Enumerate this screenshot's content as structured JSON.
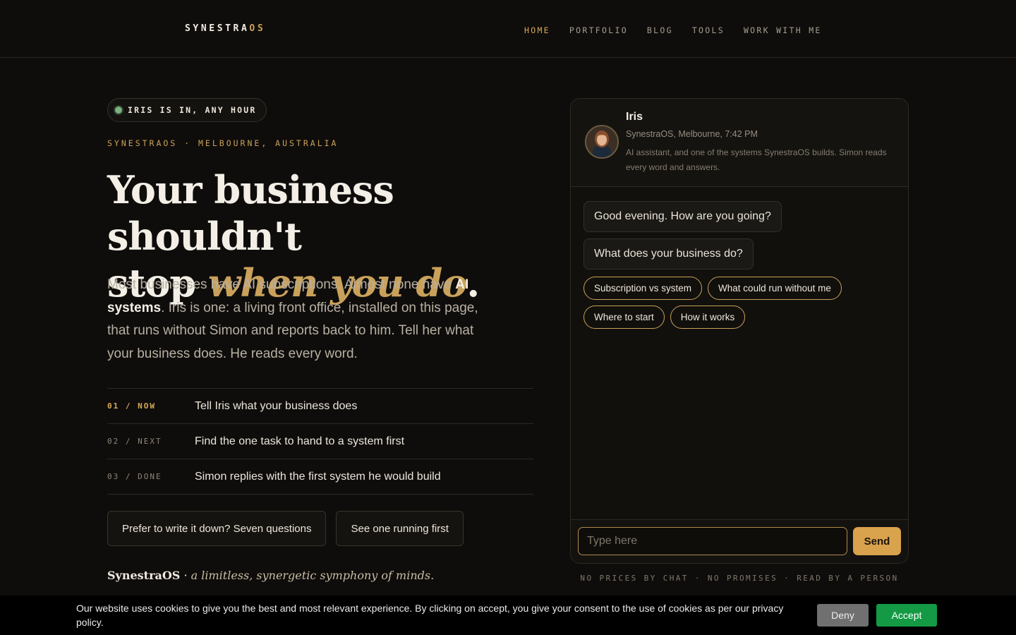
{
  "header": {
    "logo_main": "SYNESTRA",
    "logo_accent": "OS",
    "nav": [
      "HOME",
      "PORTFOLIO",
      "BLOG",
      "TOOLS",
      "WORK WITH ME"
    ]
  },
  "hero": {
    "status_pill": "IRIS IS IN, ANY HOUR",
    "location": "SYNESTRAOS · MELBOURNE, AUSTRALIA",
    "headline_1": "Your business shouldn't",
    "headline_2": "stop ",
    "headline_em": "when you do",
    "headline_end": ".",
    "lede_1": "Most businesses have AI subscriptions. Almost none have ",
    "lede_bold": "AI systems",
    "lede_2": ". Iris is one: a living front office, installed on this page, that runs without Simon and reports back to him. Tell her what your business does. He reads every word."
  },
  "steps": [
    {
      "key": "01 / NOW",
      "text": "Tell Iris what your business does"
    },
    {
      "key": "02 / NEXT",
      "text": "Find the one task to hand to a system first"
    },
    {
      "key": "03 / DONE",
      "text": "Simon replies with the first system he would build"
    }
  ],
  "buttons": {
    "write": "Prefer to write it down? Seven questions",
    "see": "See one running first"
  },
  "tagline": {
    "brand": "SynestraOS",
    "sep": " · ",
    "motto": "a limitless, synergetic symphony of minds."
  },
  "chat": {
    "name": "Iris",
    "meta": "SynestraOS, Melbourne, 7:42 PM",
    "desc": "AI assistant, and one of the systems SynestraOS builds. Simon reads every word and answers.",
    "messages": [
      "Good evening. How are you going?",
      "What does your business do?"
    ],
    "chips": [
      "Subscription vs system",
      "What could run without me",
      "Where to start",
      "How it works"
    ],
    "placeholder": "Type here",
    "send": "Send",
    "footer": "NO PRICES BY CHAT · NO PROMISES · READ BY A PERSON"
  },
  "cookie": {
    "text": "Our website uses cookies to give you the best and most relevant experience. By clicking on accept, you give your consent to the use of cookies as per our privacy policy.",
    "deny": "Deny",
    "accept": "Accept"
  },
  "colors": {
    "background": "#0f0d0b",
    "accent_gold": "#c9a15a",
    "send_button": "#d9a24c",
    "status_dot": "#79b27e",
    "accept_button": "#149a45"
  }
}
